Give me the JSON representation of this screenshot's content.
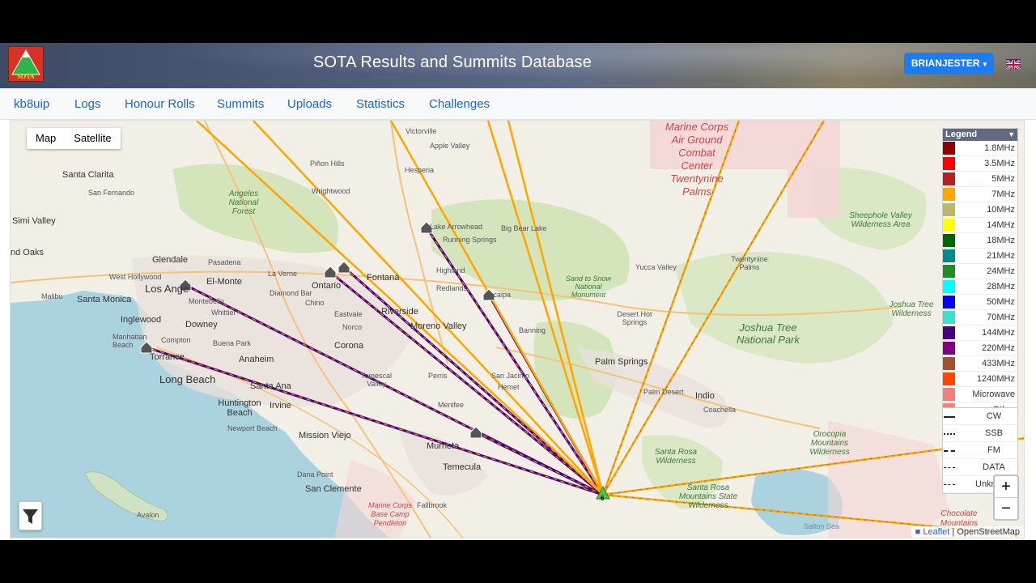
{
  "site": {
    "title": "SOTA Results and Summits Database",
    "logo_text": "SOTA"
  },
  "user": {
    "name": "BRIANJESTER",
    "caret": "▾"
  },
  "nav": [
    "kb8uip",
    "Logs",
    "Honour Rolls",
    "Summits",
    "Uploads",
    "Statistics",
    "Challenges"
  ],
  "map_type": {
    "map": "Map",
    "satellite": "Satellite"
  },
  "legend": {
    "title": "Legend",
    "bands": [
      {
        "label": "1.8MHz",
        "color": "#8b0000"
      },
      {
        "label": "3.5MHz",
        "color": "#ff0000"
      },
      {
        "label": "5MHz",
        "color": "#b22222"
      },
      {
        "label": "7MHz",
        "color": "#ffa500"
      },
      {
        "label": "10MHz",
        "color": "#bdb76b"
      },
      {
        "label": "14MHz",
        "color": "#ffff00"
      },
      {
        "label": "18MHz",
        "color": "#006400"
      },
      {
        "label": "21MHz",
        "color": "#008b8b"
      },
      {
        "label": "24MHz",
        "color": "#228b22"
      },
      {
        "label": "28MHz",
        "color": "#00ffff"
      },
      {
        "label": "50MHz",
        "color": "#0000ff"
      },
      {
        "label": "70MHz",
        "color": "#40e0d0"
      },
      {
        "label": "144MHz",
        "color": "#4b0082"
      },
      {
        "label": "220MHz",
        "color": "#800080"
      },
      {
        "label": "433MHz",
        "color": "#a0522d"
      },
      {
        "label": "1240MHz",
        "color": "#ff4500"
      },
      {
        "label": "Microwave",
        "color": "#f08080"
      },
      {
        "label": "Other",
        "color": "#fa8072"
      }
    ],
    "modes": [
      "CW",
      "SSB",
      "FM",
      "DATA",
      "Unkn"
    ]
  },
  "zoom": {
    "in": "+",
    "out": "−"
  },
  "attribution": {
    "leaflet": "Leaflet",
    "sep": "|",
    "osm": "OpenStreetMap"
  },
  "summit_marker": "6",
  "map_labels": {
    "victorville": "Victorville",
    "apple_valley": "Apple Valley",
    "hesperia": "Hesperia",
    "pinon_hills": "Piñon Hills",
    "wrightwood": "Wrightwood",
    "santa_clarita": "Santa Clarita",
    "san_fernando": "San Fernando",
    "simi_valley": "Simi Valley",
    "oaks": "nd Oaks",
    "angeles_nf": "Angeles National Forest",
    "glendale": "Glendale",
    "pasadena": "Pasadena",
    "west_hollywood": "West Hollywood",
    "los_angeles": "Los Ange",
    "el_monte": "El-Monte",
    "malibu": "Malibu",
    "santa_monica": "Santa Monica",
    "inglewood": "Inglewood",
    "downey": "Downey",
    "whittier": "Whittier",
    "montebello": "Montebello",
    "manhattan_beach": "Manhattan Beach",
    "torrance": "Torrance",
    "compton": "Compton",
    "long_beach": "Long Beach",
    "anaheim": "Anaheim",
    "buena_park": "Buena Park",
    "santa_ana": "Santa Ana",
    "irvine": "Irvine",
    "huntington_beach": "Huntington Beach",
    "newport_beach": "Newport Beach",
    "mission_viejo": "Mission Viejo",
    "dana_point": "Dana Point",
    "san_clemente": "San Clemente",
    "avalon": "Avalon",
    "ontario": "Ontario",
    "fontana": "Fontana",
    "chino": "Chino",
    "eastvale": "Eastvale",
    "norco": "Norco",
    "corona": "Corona",
    "riverside": "Riverside",
    "moreno_valley": "Moreno Valley",
    "perris": "Perris",
    "menifee": "Menifee",
    "murrieta": "Murrieta",
    "temecula": "Temecula",
    "fallbrook": "Fallbrook",
    "lake_arrowhead": "Lake Arrowhead",
    "running_springs": "Running Springs",
    "big_bear": "Big Bear Lake",
    "highland": "Highland",
    "redlands": "Redlands",
    "yucaipa": "Yucaipa",
    "banning": "Banning",
    "san_jacinto": "San Jacinto",
    "hemet": "Hemet",
    "san_bernardino_nf": "Sand to Snow National Monument",
    "yucca_valley": "Yucca Valley",
    "twentynine": "Twentynine Palms",
    "desert_hot": "Desert Hot Springs",
    "palm_springs": "Palm Springs",
    "palm_desert": "Palm Desert",
    "indio": "Indio",
    "coachella": "Coachella",
    "joshua_tree": "Joshua Tree National Park",
    "joshua_wild": "Joshua Tree Wilderness",
    "sheephole": "Sheephole Valley Wilderness Area",
    "marine_corps": "Marine Corps Air Ground Combat Center Twentynine Palms",
    "santa_rosa_wild": "Santa Rosa Wilderness",
    "santa_rosa_mtn": "Santa Rosa Mountains State Wilderness",
    "orocopia": "Orocopia Mountains Wilderness",
    "chocolate": "Chocolate Mountains",
    "salton_sea": "Salton Sea",
    "camp_pendleton": "Marine Corps Base Camp Pendleton",
    "temescal": "Temescal Valley",
    "la_verne": "La Verne",
    "diamond": "Diamond Bar"
  }
}
